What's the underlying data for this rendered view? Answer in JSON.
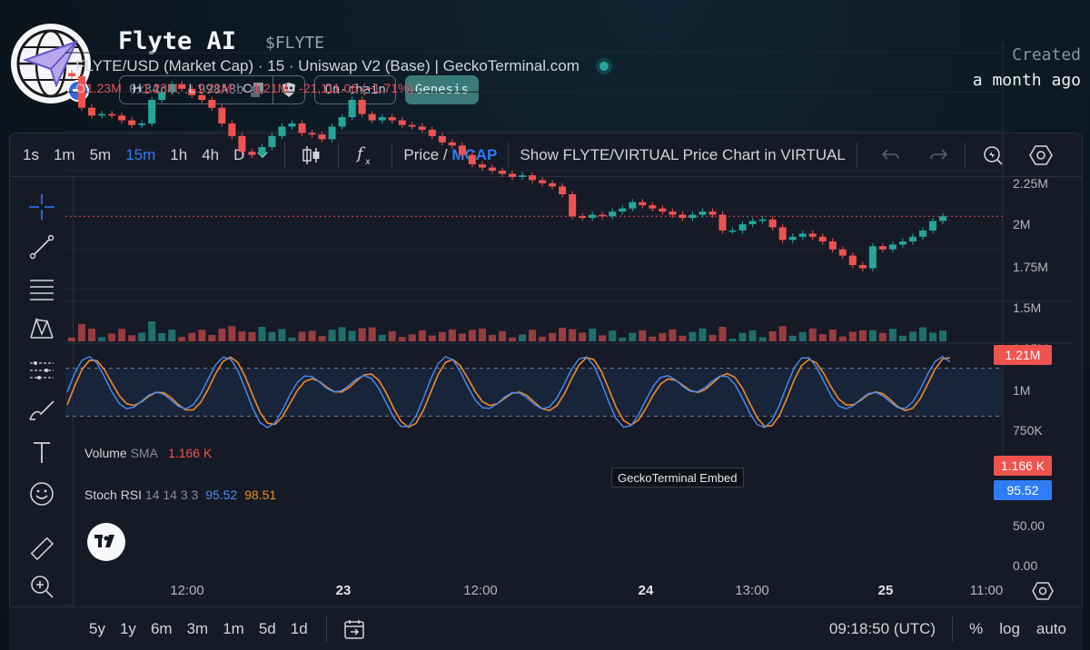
{
  "token": {
    "name": "Flyte AI",
    "ticker": "$FLYTE",
    "address_short": "0x34c4...998A8b",
    "tags": [
      "On-chain",
      "Genesis"
    ],
    "created_label": "Created",
    "created_value": "a month ago"
  },
  "toolbar": {
    "timeframes": [
      "1s",
      "1m",
      "5m",
      "15m",
      "1h",
      "4h",
      "D"
    ],
    "active_timeframe": "15m",
    "price_label": "Price /",
    "mcap_label": "MCAP",
    "show_pair": "Show FLYTE/VIRTUAL Price Chart in VIRTUAL"
  },
  "chart": {
    "title": "FLYTE/USD (Market Cap) · 15 · Uniswap V2 (Base) | GeckoTerminal.com",
    "ohlc": {
      "o_label": "O",
      "o": "1.23M",
      "h_label": "H",
      "h": "1.23M",
      "l_label": "L",
      "l": "1.21M",
      "c_label": "C",
      "c": "1.21M",
      "change": "-21,111.06 (−1.71%)"
    },
    "price_scale": [
      "2.25M",
      "2M",
      "1.75M",
      "1.5M",
      "1.25M",
      "1M",
      "750K"
    ],
    "current_price_tag": "1.21M",
    "volume_label": "Volume",
    "volume_sma_label": "SMA",
    "volume_value": "1.166 K",
    "volume_tag": "1.166 K",
    "stoch_label": "Stoch RSI",
    "stoch_params": "14 14 3 3",
    "stoch_k": "95.52",
    "stoch_d": "98.51",
    "stoch_tag": "95.52",
    "stoch_scale": [
      "50.00",
      "0.00"
    ],
    "embed_tooltip": "GeckoTerminal Embed",
    "time_axis": [
      "12:00",
      "23",
      "12:00",
      "24",
      "13:00",
      "25",
      "11:00"
    ],
    "bold_ticks": [
      "23",
      "24",
      "25"
    ]
  },
  "bottom": {
    "ranges": [
      "5y",
      "1y",
      "6m",
      "3m",
      "1m",
      "5d",
      "1d"
    ],
    "clock": "09:18:50 (UTC)",
    "percent": "%",
    "log": "log",
    "auto": "auto"
  },
  "colors": {
    "up": "#26a69a",
    "down": "#ef5350",
    "accent": "#2f7df6",
    "k_line": "#4a8cf0",
    "d_line": "#f08a24"
  },
  "chart_data": {
    "type": "candlestick",
    "title": "FLYTE/USD (Market Cap) · 15 · Uniswap V2 (Base) | GeckoTerminal.com",
    "y_unit": "USD market cap",
    "ylim": [
      750000,
      2250000
    ],
    "close_trajectory": [
      2.1,
      1.9,
      1.85,
      1.86,
      1.85,
      1.82,
      1.79,
      1.8,
      1.95,
      2.0,
      2.05,
      2.02,
      1.98,
      1.95,
      1.9,
      1.8,
      1.72,
      1.62,
      1.6,
      1.65,
      1.72,
      1.78,
      1.8,
      1.74,
      1.73,
      1.7,
      1.78,
      1.84,
      1.95,
      1.86,
      1.82,
      1.84,
      1.82,
      1.79,
      1.78,
      1.76,
      1.72,
      1.68,
      1.66,
      1.6,
      1.54,
      1.52,
      1.5,
      1.48,
      1.46,
      1.47,
      1.44,
      1.42,
      1.4,
      1.35,
      1.21,
      1.2,
      1.22,
      1.21,
      1.24,
      1.26,
      1.3,
      1.28,
      1.26,
      1.24,
      1.22,
      1.2,
      1.22,
      1.24,
      1.22,
      1.12,
      1.12,
      1.16,
      1.18,
      1.19,
      1.14,
      1.06,
      1.08,
      1.1,
      1.08,
      1.05,
      1.0,
      0.96,
      0.9,
      0.88,
      1.02,
      1.0,
      1.03,
      1.05,
      1.08,
      1.12,
      1.18,
      1.21
    ],
    "current": 1210000,
    "volume_sma": 1166,
    "stoch_rsi": {
      "k": 95.52,
      "d": 98.51,
      "params": "14 14 3 3",
      "bands": [
        20,
        80
      ]
    }
  }
}
